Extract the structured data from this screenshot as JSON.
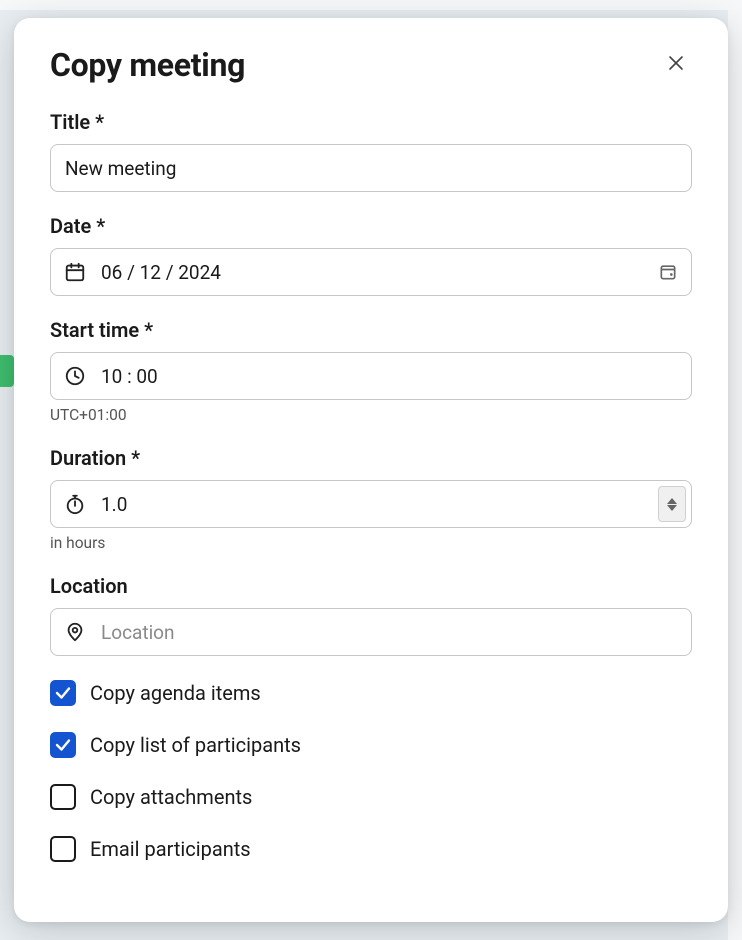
{
  "modal": {
    "title": "Copy meeting"
  },
  "form": {
    "title": {
      "label": "Title *",
      "value": "New meeting"
    },
    "date": {
      "label": "Date *",
      "value": "06 / 12 / 2024"
    },
    "start_time": {
      "label": "Start time *",
      "value": "10 : 00",
      "helper": "UTC+01:00"
    },
    "duration": {
      "label": "Duration *",
      "value": "1.0",
      "helper": "in hours"
    },
    "location": {
      "label": "Location",
      "placeholder": "Location",
      "value": ""
    }
  },
  "checkboxes": {
    "agenda": {
      "label": "Copy agenda items",
      "checked": true
    },
    "participants": {
      "label": "Copy list of participants",
      "checked": true
    },
    "attachments": {
      "label": "Copy attachments",
      "checked": false
    },
    "email": {
      "label": "Email participants",
      "checked": false
    }
  }
}
